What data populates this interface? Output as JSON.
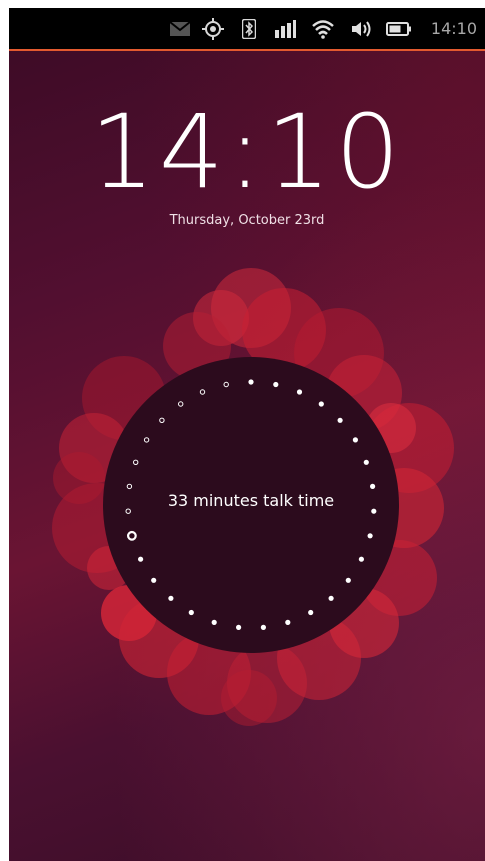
{
  "status_bar": {
    "icons": [
      "message-icon",
      "location-icon",
      "bluetooth-icon",
      "signal-icon",
      "wifi-icon",
      "volume-icon",
      "battery-icon"
    ],
    "time": "14:10",
    "accent_color": "#e35a2f"
  },
  "lock_screen": {
    "clock": "14:10",
    "date": "Thursday, October 23rd"
  },
  "infographic": {
    "label": "33 minutes talk time",
    "circle_color": "#2c0b1d",
    "bubble_color": "#d3202f"
  }
}
